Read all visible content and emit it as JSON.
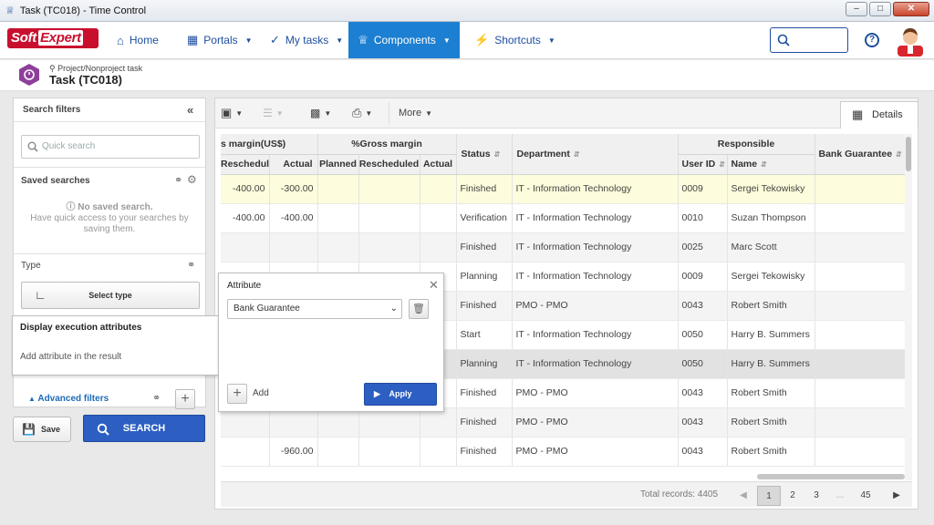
{
  "window": {
    "title": "Task (TC018) - Time Control"
  },
  "topnav": {
    "logo": {
      "a": "Soft",
      "b": "Expert"
    },
    "items": [
      {
        "label": "Home",
        "icon": "home-icon"
      },
      {
        "label": "Portals",
        "icon": "grid-icon"
      },
      {
        "label": "My tasks",
        "icon": "check-icon"
      },
      {
        "label": "Components",
        "icon": "trophy-icon",
        "active": true
      },
      {
        "label": "Shortcuts",
        "icon": "lightning-icon"
      }
    ],
    "help": "?"
  },
  "header": {
    "breadcrumb": "Project/Nonproject task",
    "title": "Task (TC018)"
  },
  "filters": {
    "title": "Search filters",
    "quick_search_placeholder": "Quick search",
    "saved_title": "Saved searches",
    "no_saved": "No saved search.",
    "saved_hint": "Have quick access to your searches by saving them.",
    "type_title": "Type",
    "select_type": "Select type",
    "advanced": "Advanced filters",
    "save": "Save",
    "search": "SEARCH"
  },
  "exec_popup": {
    "title": "Display execution attributes",
    "text": "Add attribute in the result"
  },
  "attr_popup": {
    "title": "Attribute",
    "selected": "Bank Guarantee",
    "add": "Add",
    "apply": "Apply"
  },
  "toolbar": {
    "more": "More",
    "details": "Details"
  },
  "grid": {
    "groups": {
      "gross_margin_usd": "s margin(US$)",
      "gross_margin_pct": "%Gross margin",
      "responsible": "Responsible"
    },
    "columns": {
      "rescheduled": "Rescheduled",
      "actual": "Actual",
      "planned": "Planned",
      "rescheduled2": "Rescheduled",
      "actual2": "Actual",
      "status": "Status",
      "department": "Department",
      "user_id": "User ID",
      "name": "Name",
      "bank": "Bank Guarantee"
    },
    "rows": [
      {
        "resch": "-400.00",
        "actual": "-300.00",
        "status": "Finished",
        "dept": "IT - Information Technology",
        "uid": "0009",
        "name": "Sergei Tekowisky"
      },
      {
        "resch": "-400.00",
        "actual": "-400.00",
        "status": "Verification",
        "dept": "IT - Information Technology",
        "uid": "0010",
        "name": "Suzan Thompson"
      },
      {
        "resch": "",
        "actual": "",
        "status": "Finished",
        "dept": "IT - Information Technology",
        "uid": "0025",
        "name": "Marc Scott"
      },
      {
        "resch": "",
        "actual": "",
        "status": "Planning",
        "dept": "IT - Information Technology",
        "uid": "0009",
        "name": "Sergei Tekowisky"
      },
      {
        "resch": "",
        "actual": "",
        "status": "Finished",
        "dept": "PMO - PMO",
        "uid": "0043",
        "name": "Robert Smith"
      },
      {
        "resch": "",
        "actual": "",
        "status": "Start",
        "dept": "IT - Information Technology",
        "uid": "0050",
        "name": "Harry B. Summers"
      },
      {
        "resch": "",
        "actual": "",
        "status": "Planning",
        "dept": "IT - Information Technology",
        "uid": "0050",
        "name": "Harry B. Summers"
      },
      {
        "resch": "",
        "actual": "",
        "status": "Finished",
        "dept": "PMO - PMO",
        "uid": "0043",
        "name": "Robert Smith"
      },
      {
        "resch": "",
        "actual": "",
        "status": "Finished",
        "dept": "PMO - PMO",
        "uid": "0043",
        "name": "Robert Smith"
      },
      {
        "resch": "",
        "actual": "-960.00",
        "status": "Finished",
        "dept": "PMO - PMO",
        "uid": "0043",
        "name": "Robert Smith"
      }
    ],
    "footer": {
      "total": "Total records: 4405",
      "pages": [
        "1",
        "2",
        "3",
        "...",
        "45"
      ]
    }
  }
}
